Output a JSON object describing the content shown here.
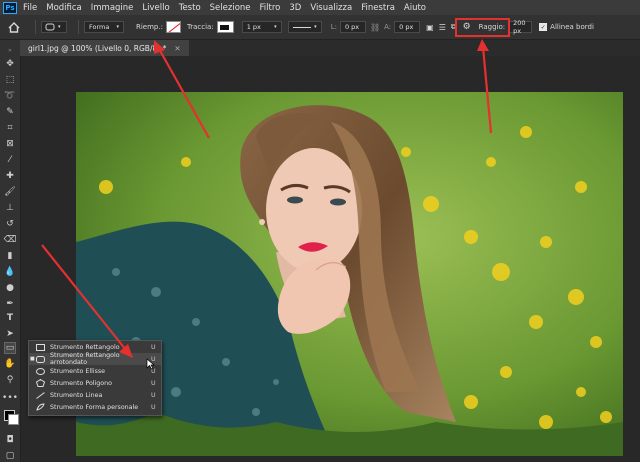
{
  "app": {
    "logo": "Ps"
  },
  "menu": [
    "File",
    "Modifica",
    "Immagine",
    "Livello",
    "Testo",
    "Selezione",
    "Filtro",
    "3D",
    "Visualizza",
    "Finestra",
    "Aiuto"
  ],
  "options": {
    "mode": "Forma",
    "fill_label": "Riemp.:",
    "stroke_label": "Traccia:",
    "stroke_width": "1 px",
    "width_label": "L:",
    "width_value": "0 px",
    "height_label": "A:",
    "height_value": "0 px",
    "radius_label": "Raggio:",
    "radius_value": "200 px",
    "align_edges_label": "Allinea bordi"
  },
  "document": {
    "tab_title": "girl1.jpg @ 100% (Livello 0, RGB/8) *"
  },
  "flyout": {
    "items": [
      {
        "label": "Strumento Rettangolo",
        "key": "U",
        "icon": "rectangle-icon"
      },
      {
        "label": "Strumento Rettangolo arrotondato",
        "key": "U",
        "icon": "rounded-rectangle-icon",
        "selected": true
      },
      {
        "label": "Strumento Ellisse",
        "key": "U",
        "icon": "ellipse-icon"
      },
      {
        "label": "Strumento Poligono",
        "key": "U",
        "icon": "polygon-icon"
      },
      {
        "label": "Strumento Linea",
        "key": "U",
        "icon": "line-icon"
      },
      {
        "label": "Strumento Forma personale",
        "key": "U",
        "icon": "custom-shape-icon"
      }
    ]
  },
  "colors": {
    "annotation": "#e53030",
    "ui_dark": "#323232",
    "menubar": "#3b3b3b"
  }
}
